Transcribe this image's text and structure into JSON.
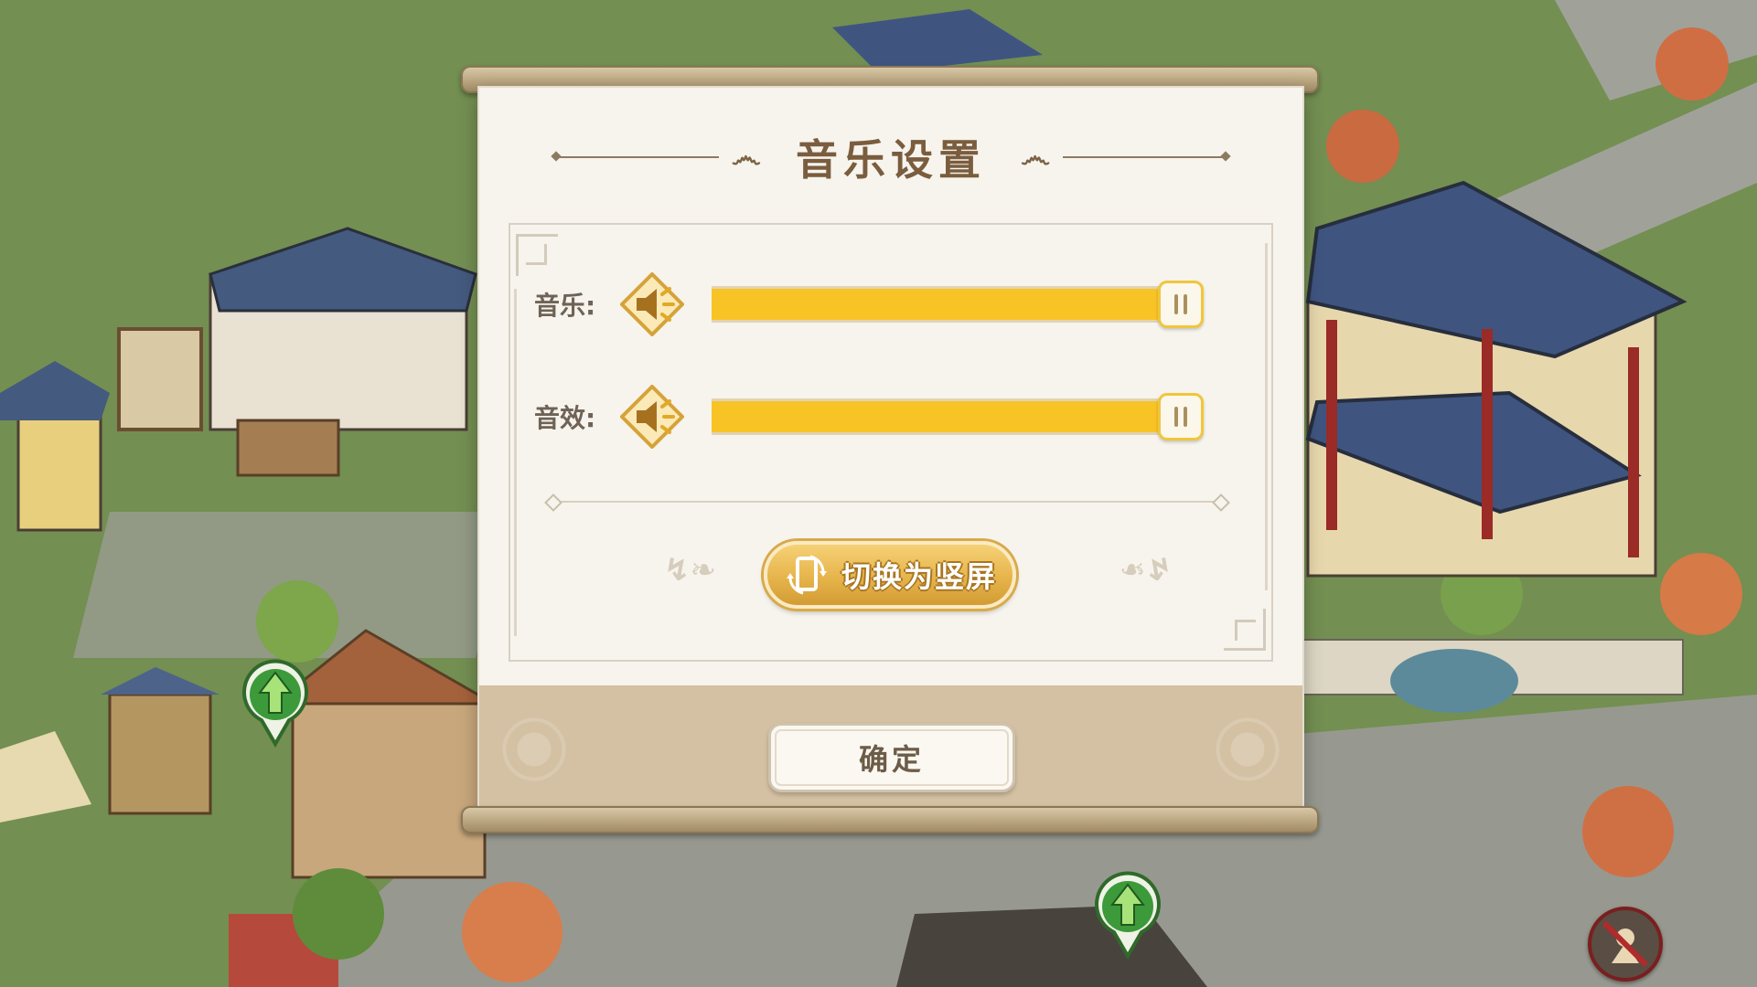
{
  "dialog": {
    "title": "音乐设置",
    "music_label": "音乐:",
    "sfx_label": "音效:",
    "music_volume": 1.0,
    "sfx_volume": 1.0,
    "orientation_button": "切换为竖屏",
    "confirm_button": "确定"
  },
  "icons": {
    "music_speaker": "speaker-icon",
    "sfx_speaker": "speaker-icon",
    "orientation": "rotate-phone-icon",
    "upgrade_marker": "green-arrow-upgrade-icon",
    "mute_toggle": "mute-icon"
  },
  "colors": {
    "slider_fill": "#f8c425",
    "button_gold": "#e6b44c",
    "dialog_bg": "#f7f4ee",
    "title_text": "#7a5d3e"
  }
}
